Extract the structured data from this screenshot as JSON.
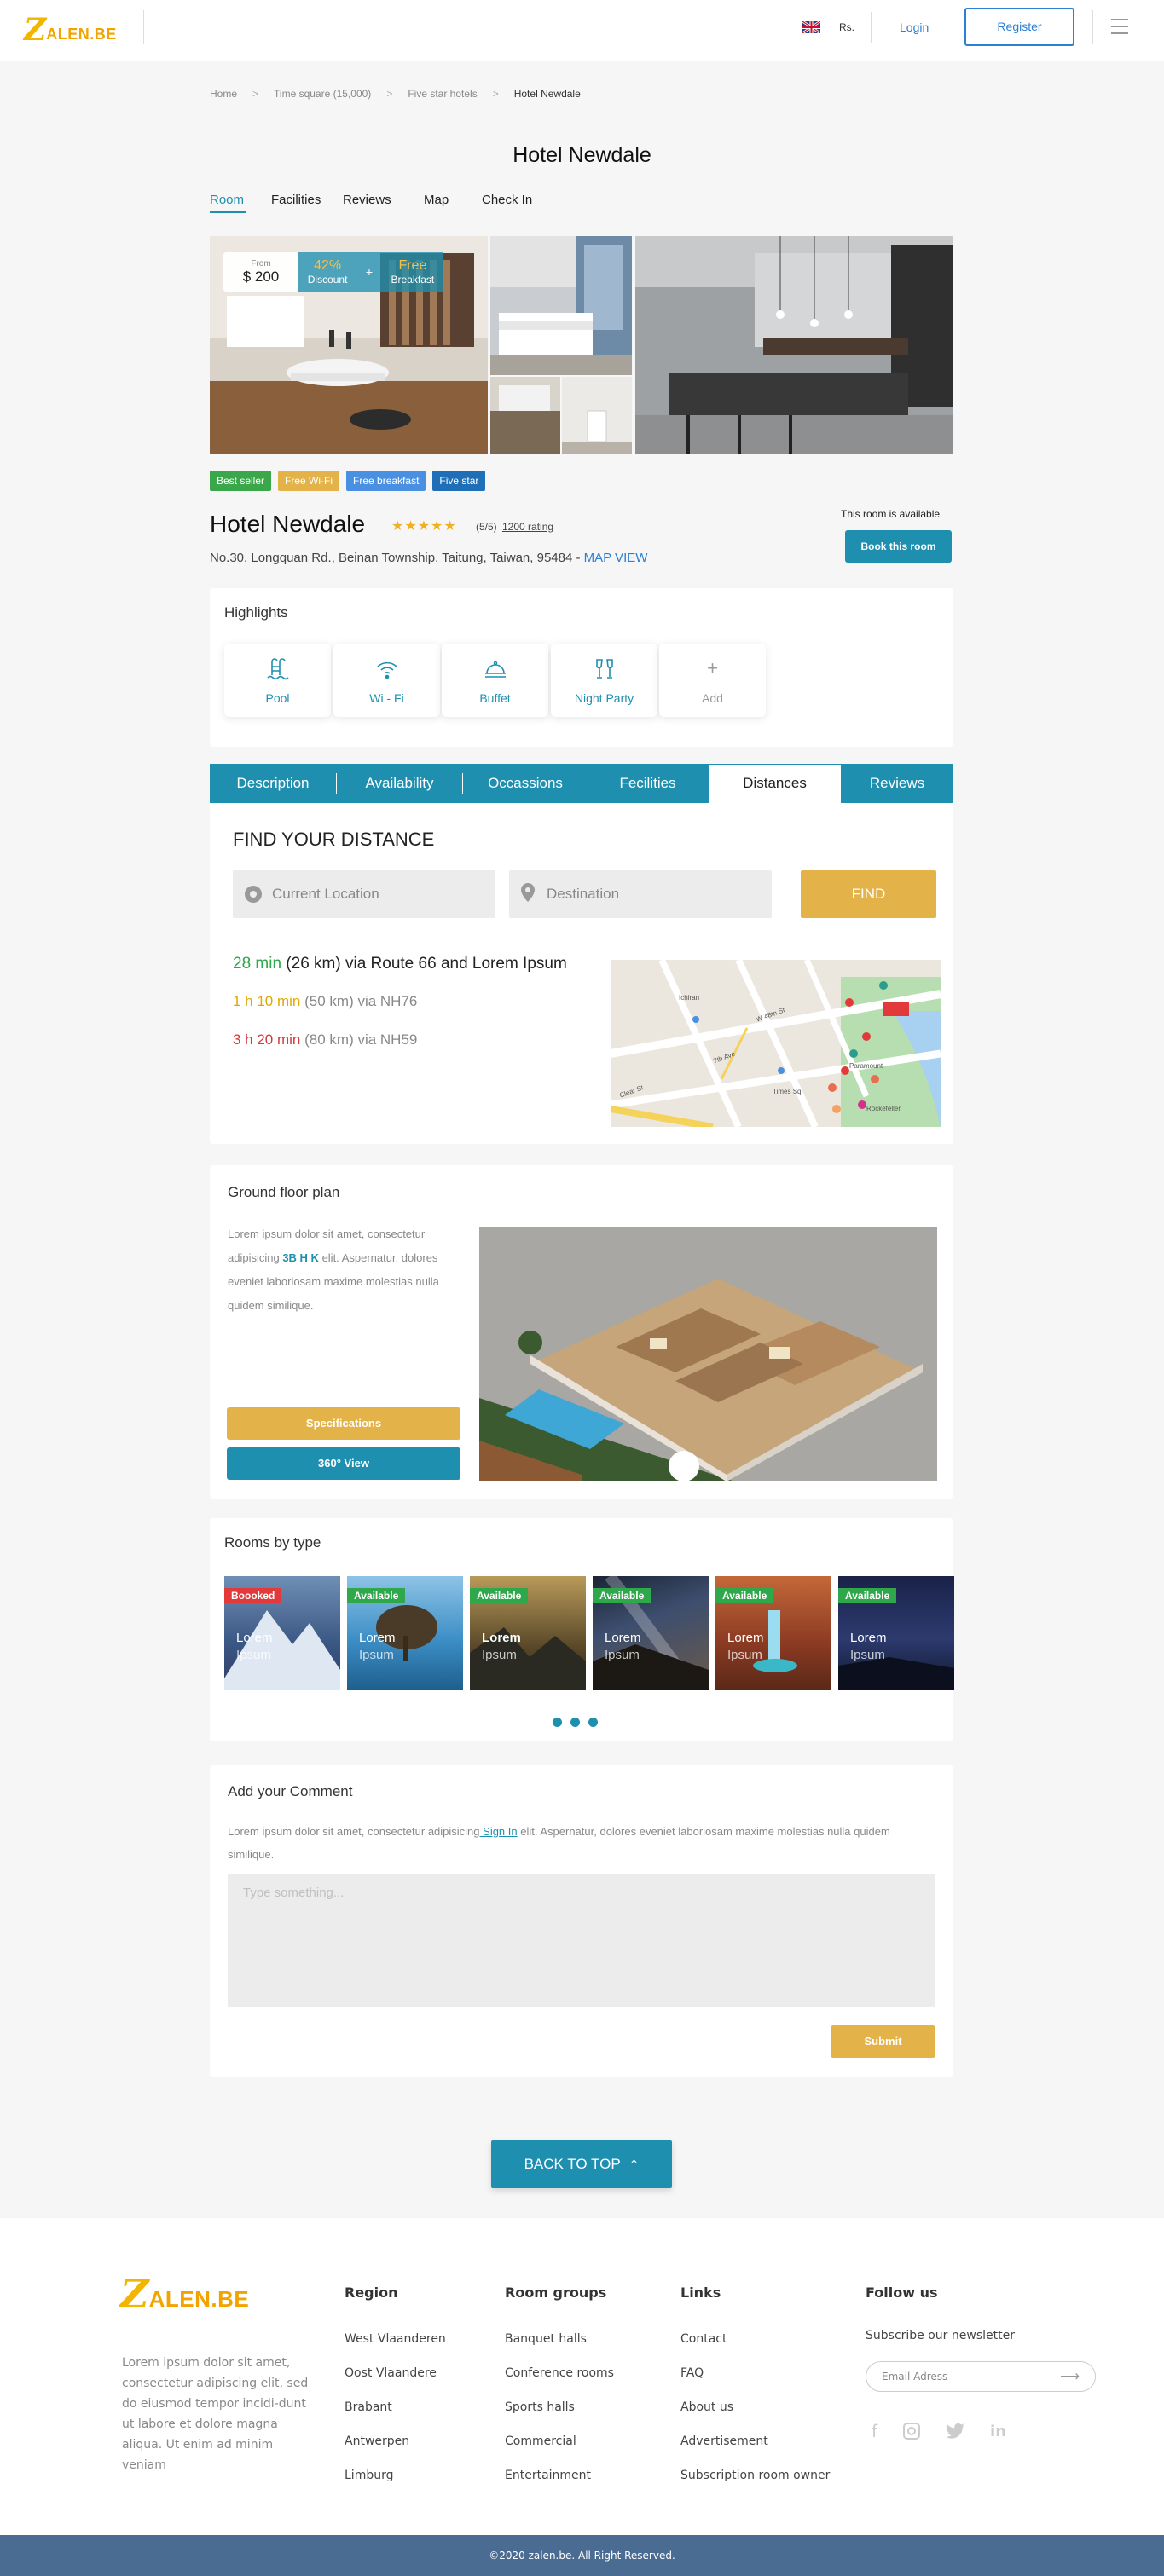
{
  "header": {
    "logo_mark": "Z",
    "logo_text": "ALEN.BE",
    "currency": "Rs.",
    "login": "Login",
    "register": "Register"
  },
  "breadcrumb": [
    "Home",
    "Time square (15,000)",
    "Five star hotels",
    "Hotel Newdale"
  ],
  "page_title": "Hotel Newdale",
  "subnav": [
    "Room",
    "Facilities",
    "Reviews",
    "Map",
    "Check In"
  ],
  "price_box": {
    "from_label": "From",
    "price": "$ 200",
    "discount_value": "42%",
    "discount_label": "Discount",
    "plus": "+",
    "free_value": "Free",
    "free_label": "Breakfast"
  },
  "tags": [
    {
      "label": "Best seller",
      "color": "#3aa84a"
    },
    {
      "label": "Free Wi-Fi",
      "color": "#e3b34a"
    },
    {
      "label": "Free breakfast",
      "color": "#4a90e2"
    },
    {
      "label": "Five star",
      "color": "#1f6fb8"
    }
  ],
  "hotel": {
    "name": "Hotel Newdale",
    "stars": "★★★★★",
    "rating_score": "(5/5)",
    "rating_count": "1200 rating",
    "address": "No.30, Longquan Rd., Beinan Township, Taitung, Taiwan, 95484 -",
    "map_link": "MAP VIEW",
    "availability": "This room is available",
    "book_button": "Book this room"
  },
  "highlights": {
    "title": "Highlights",
    "items": [
      {
        "label": "Pool",
        "icon": "pool-icon"
      },
      {
        "label": "Wi - Fi",
        "icon": "wifi-icon"
      },
      {
        "label": "Buffet",
        "icon": "buffet-icon"
      },
      {
        "label": "Night Party",
        "icon": "party-icon"
      }
    ],
    "add_icon": "+",
    "add_label": "Add"
  },
  "info_tabs": [
    "Description",
    "Availability",
    "Occassions",
    "Fecilities",
    "Distances",
    "Reviews"
  ],
  "distance": {
    "title": "FIND YOUR DISTANCE",
    "current_placeholder": "Current Location",
    "destination_placeholder": "Destination",
    "find_button": "FIND",
    "routes": [
      {
        "time": "28 min",
        "rest": " (26 km) via Route 66 and Lorem Ipsum",
        "color": "#2ea84a",
        "rest_color": "#222"
      },
      {
        "time": "1 h 10 min",
        "rest": " (50 km) via NH76",
        "color": "#e3a700",
        "rest_color": "#888"
      },
      {
        "time": "3 h 20 min",
        "rest": " (80 km) via NH59",
        "color": "#d33a3a",
        "rest_color": "#888"
      }
    ],
    "map_labels": [
      "Ichiran",
      "Clear St",
      "W 48th St",
      "7th Ave",
      "Times Sq",
      "Paramount",
      "Rockefeller"
    ]
  },
  "floor_plan": {
    "title": "Ground floor plan",
    "text_before": "Lorem ipsum dolor sit amet, consectetur adipisicing ",
    "highlight": "3B H K",
    "text_after": " elit. Aspernatur, dolores eveniet laboriosam maxime molestias nulla quidem similique.",
    "spec_button": "Specifications",
    "view_button": "360° View"
  },
  "rooms": {
    "title": "Rooms by type",
    "items": [
      {
        "badge": "Boooked",
        "badge_color": "#e23a3a",
        "line1": "Lorem",
        "line2": "Ipsum"
      },
      {
        "badge": "Available",
        "badge_color": "#2ea84a",
        "line1": "Lorem",
        "line2": "Ipsum"
      },
      {
        "badge": "Available",
        "badge_color": "#2ea84a",
        "line1": "Lorem",
        "line2": "Ipsum"
      },
      {
        "badge": "Available",
        "badge_color": "#2ea84a",
        "line1": "Lorem",
        "line2": "Ipsum"
      },
      {
        "badge": "Available",
        "badge_color": "#2ea84a",
        "line1": "Lorem",
        "line2": "Ipsum"
      },
      {
        "badge": "Available",
        "badge_color": "#2ea84a",
        "line1": "Lorem",
        "line2": "Ipsum"
      }
    ]
  },
  "comment": {
    "title": "Add your Comment",
    "text_before": "Lorem ipsum dolor sit amet, consectetur adipisicing",
    "sign_in": " Sign In",
    "text_after": " elit. Aspernatur, dolores eveniet laboriosam maxime molestias nulla quidem similique.",
    "placeholder": "Type something...",
    "submit": "Submit"
  },
  "back_to_top": "BACK TO TOP",
  "footer": {
    "about": "Lorem ipsum dolor sit amet, consectetur adipiscing elit, sed do eiusmod tempor incidi-dunt ut labore et dolore magna aliqua. Ut enim ad minim veniam",
    "region_title": "Region",
    "regions": [
      "West Vlaanderen",
      "Oost Vlaandere",
      "Brabant",
      "Antwerpen",
      "Limburg"
    ],
    "groups_title": "Room groups",
    "groups": [
      "Banquet halls",
      "Conference rooms",
      "Sports halls",
      "Commercial",
      "Entertainment"
    ],
    "links_title": "Links",
    "links": [
      "Contact",
      "FAQ",
      "About us",
      "Advertisement",
      "Subscription room owner"
    ],
    "follow_title": "Follow us",
    "newsletter": "Subscribe our newsletter",
    "email_placeholder": "Email Adress",
    "social": [
      "facebook-icon",
      "instagram-icon",
      "twitter-icon",
      "linkedin-icon"
    ]
  },
  "copyright": "©2020 zalen.be. All Right Reserved.",
  "colors": {
    "primary": "#1f8fb0",
    "gold": "#e3b34a",
    "footer_bar": "#4a6c93"
  }
}
